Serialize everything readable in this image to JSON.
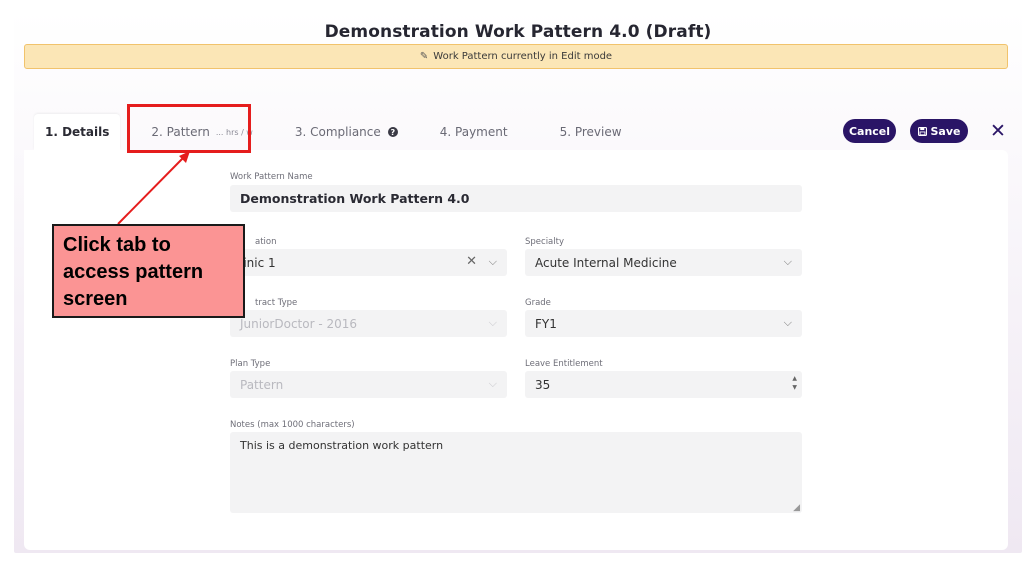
{
  "page": {
    "title": "Demonstration Work Pattern 4.0 (Draft)",
    "banner": "Work Pattern currently in Edit mode"
  },
  "tabs": [
    {
      "label": "1. Details",
      "active": true
    },
    {
      "label": "2. Pattern",
      "suffix": "... hrs / w"
    },
    {
      "label": "3. Compliance",
      "help_icon": "?"
    },
    {
      "label": "4. Payment"
    },
    {
      "label": "5. Preview"
    }
  ],
  "actions": {
    "cancel_label": "Cancel",
    "save_label": "Save",
    "close_glyph": "✕"
  },
  "form": {
    "name": {
      "label": "Work Pattern Name",
      "value": "Demonstration Work Pattern 4.0"
    },
    "location": {
      "label": "ation",
      "value": "linic 1"
    },
    "specialty": {
      "label": "Specialty",
      "value": "Acute Internal Medicine"
    },
    "contract_type": {
      "label": "tract Type",
      "value": "JuniorDoctor - 2016"
    },
    "grade": {
      "label": "Grade",
      "value": "FY1"
    },
    "plan_type": {
      "label": "Plan Type",
      "value": "Pattern"
    },
    "leave_entitlement": {
      "label": "Leave Entitlement",
      "value": "35"
    },
    "notes": {
      "label": "Notes (max 1000 characters)",
      "value": "This is a demonstration work pattern"
    }
  },
  "annotation": {
    "callout_text": "Click tab to access pattern screen",
    "color": "#e51d1d"
  },
  "colors": {
    "primary": "#2a1566",
    "banner_bg": "#fbe6b6",
    "banner_border": "#f1c36c",
    "callout_bg": "#fb9494"
  },
  "icons": {
    "pencil": "pencil-icon",
    "help": "help-circle-icon",
    "save": "floppy-disk-icon",
    "close": "close-icon",
    "chevron": "chevron-down-icon",
    "clear": "clear-x-icon"
  }
}
